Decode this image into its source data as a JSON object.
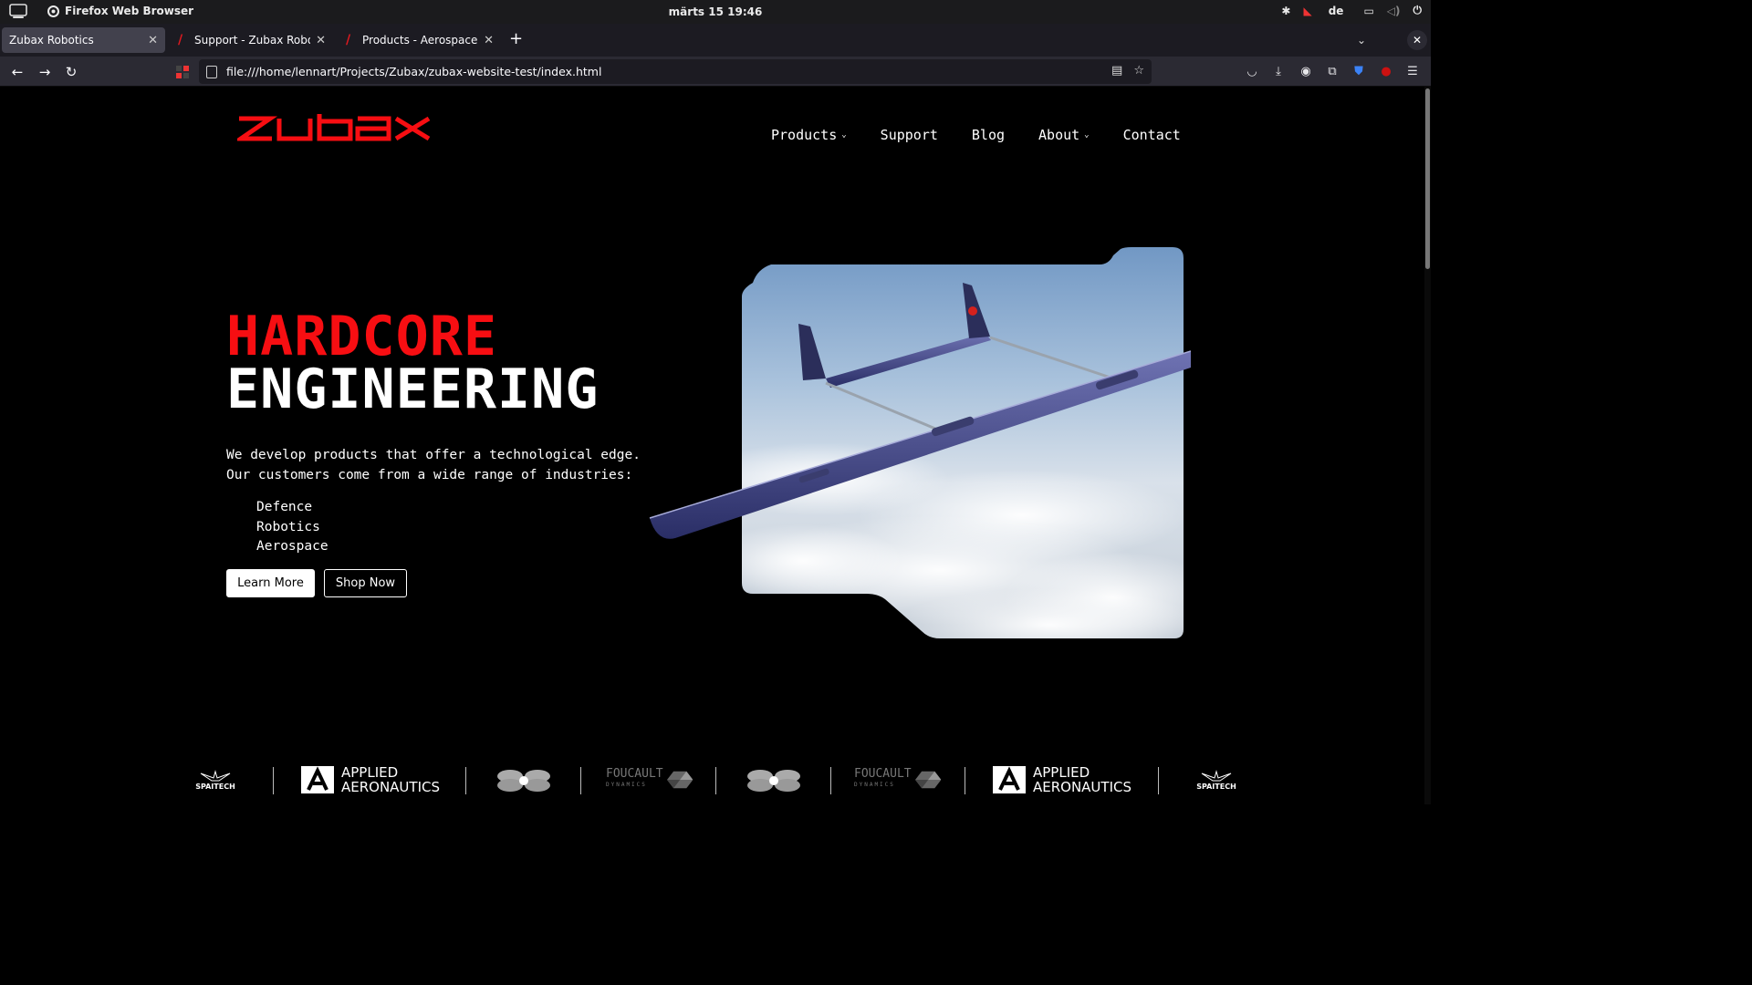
{
  "system_bar": {
    "app_name": "Firefox Web Browser",
    "clock": "märts 15  19:46",
    "keyboard_layout": "de"
  },
  "browser": {
    "tabs": [
      {
        "title": "Zubax Robotics",
        "active": true
      },
      {
        "title": "Support - Zubax Robotics",
        "active": false
      },
      {
        "title": "Products - Aerospace and",
        "active": false
      }
    ],
    "url": "file:///home/lennart/Projects/Zubax/zubax-website-test/index.html"
  },
  "site": {
    "logo_text": "zubax",
    "brand_color": "#f70e12",
    "nav": [
      {
        "label": "Products",
        "dropdown": true
      },
      {
        "label": "Support",
        "dropdown": false
      },
      {
        "label": "Blog",
        "dropdown": false
      },
      {
        "label": "About",
        "dropdown": true
      },
      {
        "label": "Contact",
        "dropdown": false
      }
    ],
    "hero": {
      "title_line1": "HARDCORE",
      "title_line2": "ENGINEERING",
      "desc_line1": "We develop products that offer a technological edge.",
      "desc_line2": "Our customers come from a wide range of industries:",
      "industries": [
        "Defence",
        "Robotics",
        "Aerospace"
      ],
      "primary_button": "Learn More",
      "secondary_button": "Shop Now"
    },
    "partners": [
      {
        "name": "SPAITECH",
        "icon": "spaitech-logo"
      },
      {
        "name": "APPLIED AERONAUTICS",
        "line1": "APPLIED",
        "line2": "AERONAUTICS",
        "icon": "applied-aeronautics-logo"
      },
      {
        "name": "flower-drone",
        "icon": "flower-logo"
      },
      {
        "name": "FOUCAULT DYNAMICS",
        "line1": "FOUCAULT",
        "line2": "DYNAMICS",
        "icon": "foucault-logo"
      },
      {
        "name": "flower-drone",
        "icon": "flower-logo"
      },
      {
        "name": "FOUCAULT DYNAMICS",
        "line1": "FOUCAULT",
        "line2": "DYNAMICS",
        "icon": "foucault-logo"
      },
      {
        "name": "APPLIED AERONAUTICS",
        "line1": "APPLIED",
        "line2": "AERONAUTICS",
        "icon": "applied-aeronautics-logo"
      },
      {
        "name": "SPAITECH",
        "icon": "spaitech-logo"
      }
    ]
  }
}
